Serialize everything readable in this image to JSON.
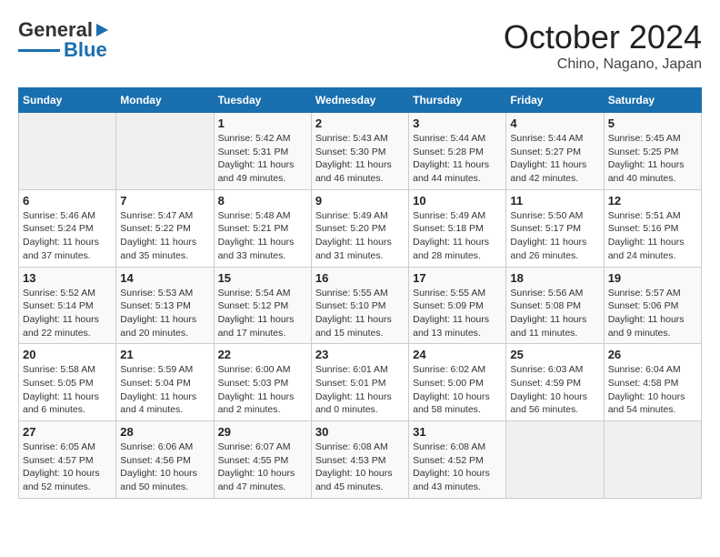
{
  "logo": {
    "line1": "General",
    "line2": "Blue"
  },
  "title": "October 2024",
  "subtitle": "Chino, Nagano, Japan",
  "weekdays": [
    "Sunday",
    "Monday",
    "Tuesday",
    "Wednesday",
    "Thursday",
    "Friday",
    "Saturday"
  ],
  "weeks": [
    [
      {
        "day": "",
        "sunrise": "",
        "sunset": "",
        "daylight": ""
      },
      {
        "day": "",
        "sunrise": "",
        "sunset": "",
        "daylight": ""
      },
      {
        "day": "1",
        "sunrise": "Sunrise: 5:42 AM",
        "sunset": "Sunset: 5:31 PM",
        "daylight": "Daylight: 11 hours and 49 minutes."
      },
      {
        "day": "2",
        "sunrise": "Sunrise: 5:43 AM",
        "sunset": "Sunset: 5:30 PM",
        "daylight": "Daylight: 11 hours and 46 minutes."
      },
      {
        "day": "3",
        "sunrise": "Sunrise: 5:44 AM",
        "sunset": "Sunset: 5:28 PM",
        "daylight": "Daylight: 11 hours and 44 minutes."
      },
      {
        "day": "4",
        "sunrise": "Sunrise: 5:44 AM",
        "sunset": "Sunset: 5:27 PM",
        "daylight": "Daylight: 11 hours and 42 minutes."
      },
      {
        "day": "5",
        "sunrise": "Sunrise: 5:45 AM",
        "sunset": "Sunset: 5:25 PM",
        "daylight": "Daylight: 11 hours and 40 minutes."
      }
    ],
    [
      {
        "day": "6",
        "sunrise": "Sunrise: 5:46 AM",
        "sunset": "Sunset: 5:24 PM",
        "daylight": "Daylight: 11 hours and 37 minutes."
      },
      {
        "day": "7",
        "sunrise": "Sunrise: 5:47 AM",
        "sunset": "Sunset: 5:22 PM",
        "daylight": "Daylight: 11 hours and 35 minutes."
      },
      {
        "day": "8",
        "sunrise": "Sunrise: 5:48 AM",
        "sunset": "Sunset: 5:21 PM",
        "daylight": "Daylight: 11 hours and 33 minutes."
      },
      {
        "day": "9",
        "sunrise": "Sunrise: 5:49 AM",
        "sunset": "Sunset: 5:20 PM",
        "daylight": "Daylight: 11 hours and 31 minutes."
      },
      {
        "day": "10",
        "sunrise": "Sunrise: 5:49 AM",
        "sunset": "Sunset: 5:18 PM",
        "daylight": "Daylight: 11 hours and 28 minutes."
      },
      {
        "day": "11",
        "sunrise": "Sunrise: 5:50 AM",
        "sunset": "Sunset: 5:17 PM",
        "daylight": "Daylight: 11 hours and 26 minutes."
      },
      {
        "day": "12",
        "sunrise": "Sunrise: 5:51 AM",
        "sunset": "Sunset: 5:16 PM",
        "daylight": "Daylight: 11 hours and 24 minutes."
      }
    ],
    [
      {
        "day": "13",
        "sunrise": "Sunrise: 5:52 AM",
        "sunset": "Sunset: 5:14 PM",
        "daylight": "Daylight: 11 hours and 22 minutes."
      },
      {
        "day": "14",
        "sunrise": "Sunrise: 5:53 AM",
        "sunset": "Sunset: 5:13 PM",
        "daylight": "Daylight: 11 hours and 20 minutes."
      },
      {
        "day": "15",
        "sunrise": "Sunrise: 5:54 AM",
        "sunset": "Sunset: 5:12 PM",
        "daylight": "Daylight: 11 hours and 17 minutes."
      },
      {
        "day": "16",
        "sunrise": "Sunrise: 5:55 AM",
        "sunset": "Sunset: 5:10 PM",
        "daylight": "Daylight: 11 hours and 15 minutes."
      },
      {
        "day": "17",
        "sunrise": "Sunrise: 5:55 AM",
        "sunset": "Sunset: 5:09 PM",
        "daylight": "Daylight: 11 hours and 13 minutes."
      },
      {
        "day": "18",
        "sunrise": "Sunrise: 5:56 AM",
        "sunset": "Sunset: 5:08 PM",
        "daylight": "Daylight: 11 hours and 11 minutes."
      },
      {
        "day": "19",
        "sunrise": "Sunrise: 5:57 AM",
        "sunset": "Sunset: 5:06 PM",
        "daylight": "Daylight: 11 hours and 9 minutes."
      }
    ],
    [
      {
        "day": "20",
        "sunrise": "Sunrise: 5:58 AM",
        "sunset": "Sunset: 5:05 PM",
        "daylight": "Daylight: 11 hours and 6 minutes."
      },
      {
        "day": "21",
        "sunrise": "Sunrise: 5:59 AM",
        "sunset": "Sunset: 5:04 PM",
        "daylight": "Daylight: 11 hours and 4 minutes."
      },
      {
        "day": "22",
        "sunrise": "Sunrise: 6:00 AM",
        "sunset": "Sunset: 5:03 PM",
        "daylight": "Daylight: 11 hours and 2 minutes."
      },
      {
        "day": "23",
        "sunrise": "Sunrise: 6:01 AM",
        "sunset": "Sunset: 5:01 PM",
        "daylight": "Daylight: 11 hours and 0 minutes."
      },
      {
        "day": "24",
        "sunrise": "Sunrise: 6:02 AM",
        "sunset": "Sunset: 5:00 PM",
        "daylight": "Daylight: 10 hours and 58 minutes."
      },
      {
        "day": "25",
        "sunrise": "Sunrise: 6:03 AM",
        "sunset": "Sunset: 4:59 PM",
        "daylight": "Daylight: 10 hours and 56 minutes."
      },
      {
        "day": "26",
        "sunrise": "Sunrise: 6:04 AM",
        "sunset": "Sunset: 4:58 PM",
        "daylight": "Daylight: 10 hours and 54 minutes."
      }
    ],
    [
      {
        "day": "27",
        "sunrise": "Sunrise: 6:05 AM",
        "sunset": "Sunset: 4:57 PM",
        "daylight": "Daylight: 10 hours and 52 minutes."
      },
      {
        "day": "28",
        "sunrise": "Sunrise: 6:06 AM",
        "sunset": "Sunset: 4:56 PM",
        "daylight": "Daylight: 10 hours and 50 minutes."
      },
      {
        "day": "29",
        "sunrise": "Sunrise: 6:07 AM",
        "sunset": "Sunset: 4:55 PM",
        "daylight": "Daylight: 10 hours and 47 minutes."
      },
      {
        "day": "30",
        "sunrise": "Sunrise: 6:08 AM",
        "sunset": "Sunset: 4:53 PM",
        "daylight": "Daylight: 10 hours and 45 minutes."
      },
      {
        "day": "31",
        "sunrise": "Sunrise: 6:08 AM",
        "sunset": "Sunset: 4:52 PM",
        "daylight": "Daylight: 10 hours and 43 minutes."
      },
      {
        "day": "",
        "sunrise": "",
        "sunset": "",
        "daylight": ""
      },
      {
        "day": "",
        "sunrise": "",
        "sunset": "",
        "daylight": ""
      }
    ]
  ]
}
